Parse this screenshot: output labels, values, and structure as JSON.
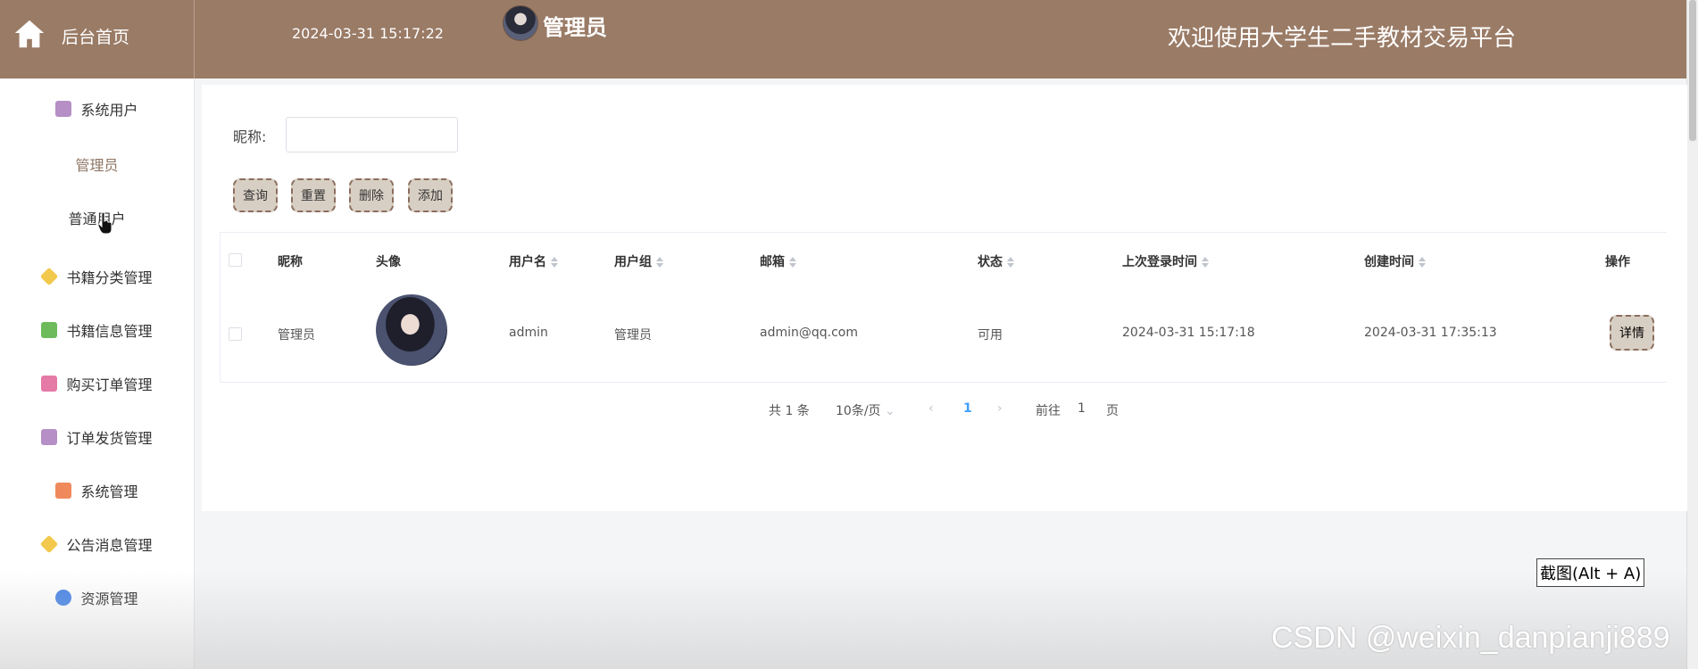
{
  "header": {
    "home_label": "后台首页",
    "datetime": "2024-03-31 15:17:22",
    "role": "管理员",
    "welcome": "欢迎使用大学生二手教材交易平台"
  },
  "sidebar": {
    "items": [
      {
        "label": "系统用户",
        "icon": "archive-icon",
        "color": "#b58fc5"
      },
      {
        "label": "书籍分类管理",
        "icon": "cube-icon",
        "color": "#f2c94c"
      },
      {
        "label": "书籍信息管理",
        "icon": "message-icon",
        "color": "#6dbb5b"
      },
      {
        "label": "购买订单管理",
        "icon": "store-icon",
        "color": "#e57aa6"
      },
      {
        "label": "订单发货管理",
        "icon": "archive-icon",
        "color": "#b58fc5"
      },
      {
        "label": "系统管理",
        "icon": "grid-icon",
        "color": "#f08a5d"
      },
      {
        "label": "公告消息管理",
        "icon": "cube-icon",
        "color": "#f2c94c"
      },
      {
        "label": "资源管理",
        "icon": "star-icon",
        "color": "#4a86e8"
      }
    ],
    "sub_items": [
      "管理员",
      "普通用户"
    ]
  },
  "search": {
    "label": "昵称:",
    "value": "",
    "placeholder": ""
  },
  "buttons": {
    "query": "查询",
    "reset": "重置",
    "delete": "删除",
    "add": "添加"
  },
  "table": {
    "headers": [
      "昵称",
      "头像",
      "用户名",
      "用户组",
      "邮箱",
      "状态",
      "上次登录时间",
      "创建时间",
      "操作"
    ],
    "rows": [
      {
        "nickname": "管理员",
        "username": "admin",
        "group": "管理员",
        "email": "admin@qq.com",
        "status": "可用",
        "last_login": "2024-03-31 15:17:18",
        "created": "2024-03-31 17:35:13",
        "action": "详情"
      }
    ]
  },
  "pagination": {
    "total": "共 1 条",
    "page_size": "10条/页",
    "current_page": "1",
    "goto_label": "前往",
    "goto_value": "1",
    "page_unit": "页"
  },
  "tooltip": "截图(Alt + A)",
  "watermark": "CSDN @weixin_danpianji889",
  "colors": {
    "header_bg": "#9a7b66",
    "button_bg": "#d8cfc4",
    "accent": "#409eff"
  }
}
